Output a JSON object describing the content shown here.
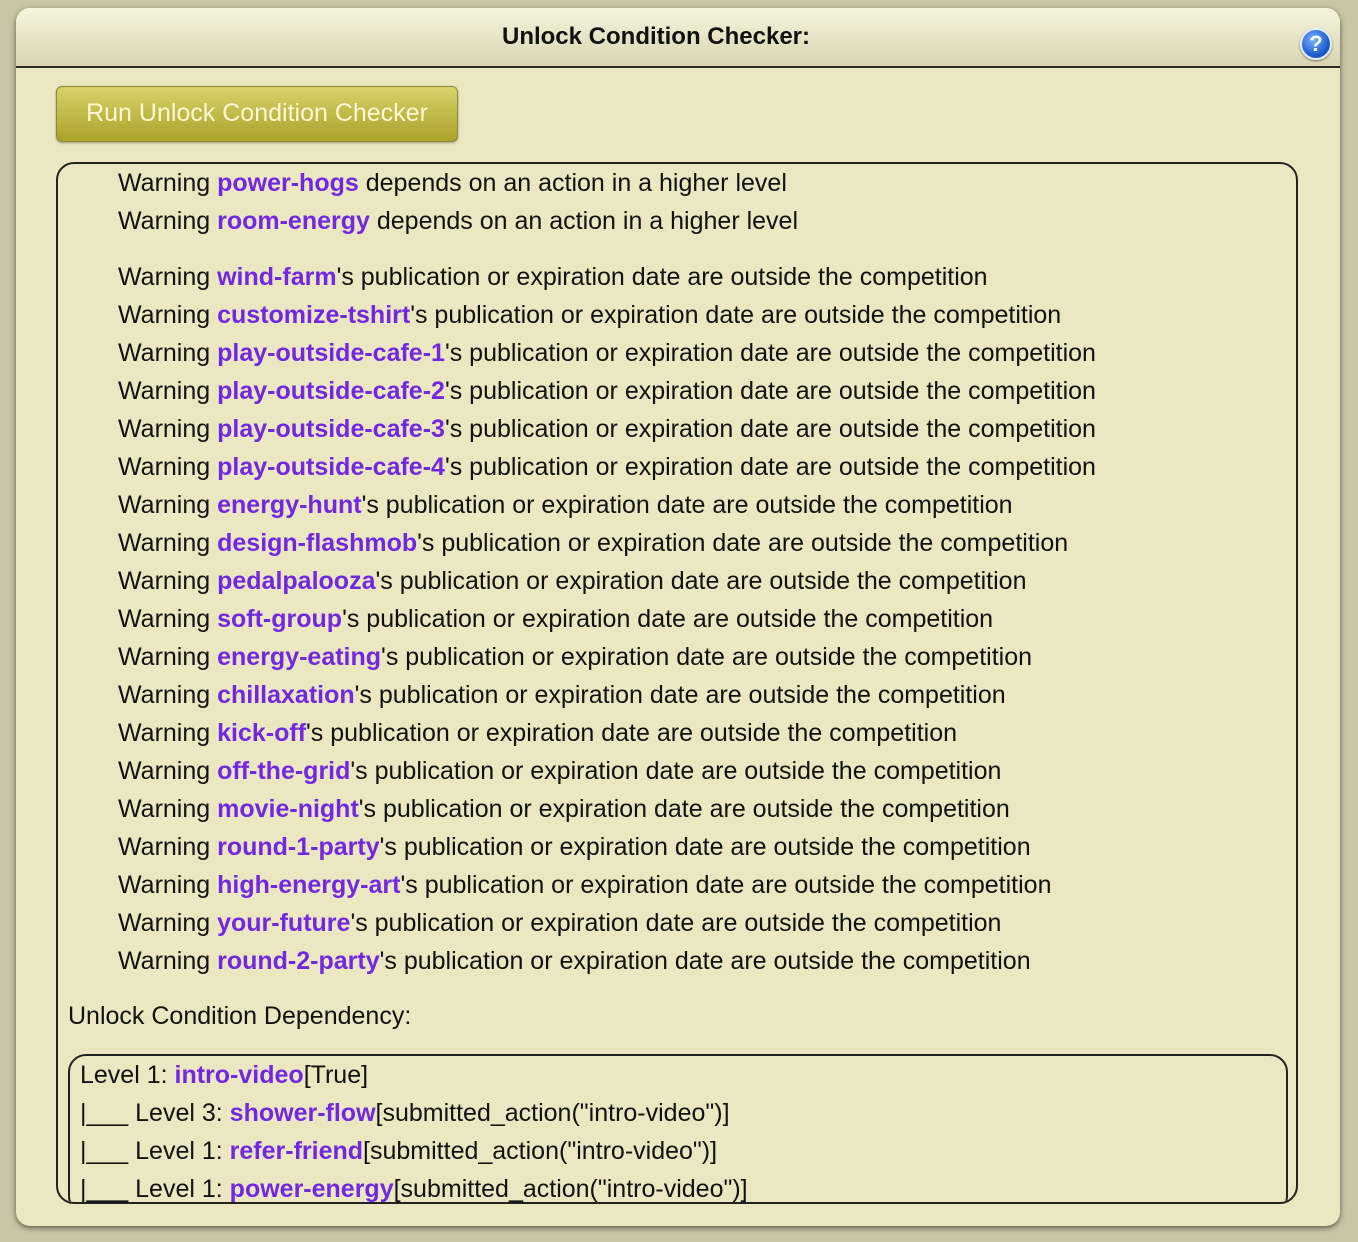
{
  "title": "Unlock Condition Checker:",
  "help_label": "?",
  "run_button_label": "Run Unlock Condition Checker",
  "warning_prefix": "Warning ",
  "higher_level_warnings": [
    {
      "action": "power-hogs",
      "message": " depends on an action in a higher level"
    },
    {
      "action": "room-energy",
      "message": " depends on an action in a higher level"
    }
  ],
  "date_warnings": [
    {
      "action": "wind-farm",
      "message": "'s publication or expiration date are outside the competition"
    },
    {
      "action": "customize-tshirt",
      "message": "'s publication or expiration date are outside the competition"
    },
    {
      "action": "play-outside-cafe-1",
      "message": "'s publication or expiration date are outside the competition"
    },
    {
      "action": "play-outside-cafe-2",
      "message": "'s publication or expiration date are outside the competition"
    },
    {
      "action": "play-outside-cafe-3",
      "message": "'s publication or expiration date are outside the competition"
    },
    {
      "action": "play-outside-cafe-4",
      "message": "'s publication or expiration date are outside the competition"
    },
    {
      "action": "energy-hunt",
      "message": "'s publication or expiration date are outside the competition"
    },
    {
      "action": "design-flashmob",
      "message": "'s publication or expiration date are outside the competition"
    },
    {
      "action": "pedalpalooza",
      "message": "'s publication or expiration date are outside the competition"
    },
    {
      "action": "soft-group",
      "message": "'s publication or expiration date are outside the competition"
    },
    {
      "action": "energy-eating",
      "message": "'s publication or expiration date are outside the competition"
    },
    {
      "action": "chillaxation",
      "message": "'s publication or expiration date are outside the competition"
    },
    {
      "action": "kick-off",
      "message": "'s publication or expiration date are outside the competition"
    },
    {
      "action": "off-the-grid",
      "message": "'s publication or expiration date are outside the competition"
    },
    {
      "action": "movie-night",
      "message": "'s publication or expiration date are outside the competition"
    },
    {
      "action": "round-1-party",
      "message": "'s publication or expiration date are outside the competition"
    },
    {
      "action": "high-energy-art",
      "message": "'s publication or expiration date are outside the competition"
    },
    {
      "action": "your-future",
      "message": "'s publication or expiration date are outside the competition"
    },
    {
      "action": "round-2-party",
      "message": "'s publication or expiration date are outside the competition"
    }
  ],
  "dependency_heading": "Unlock Condition Dependency:",
  "dependencies": [
    {
      "prefix": "Level 1: ",
      "action": "intro-video",
      "condition": "[True]"
    },
    {
      "prefix": "|___ Level 3: ",
      "action": "shower-flow",
      "condition": "[submitted_action(\"intro-video\")]"
    },
    {
      "prefix": "|___ Level 1: ",
      "action": "refer-friend",
      "condition": "[submitted_action(\"intro-video\")]"
    },
    {
      "prefix": "|___ Level 1: ",
      "action": "power-energy",
      "condition": "[submitted_action(\"intro-video\")]"
    }
  ]
}
